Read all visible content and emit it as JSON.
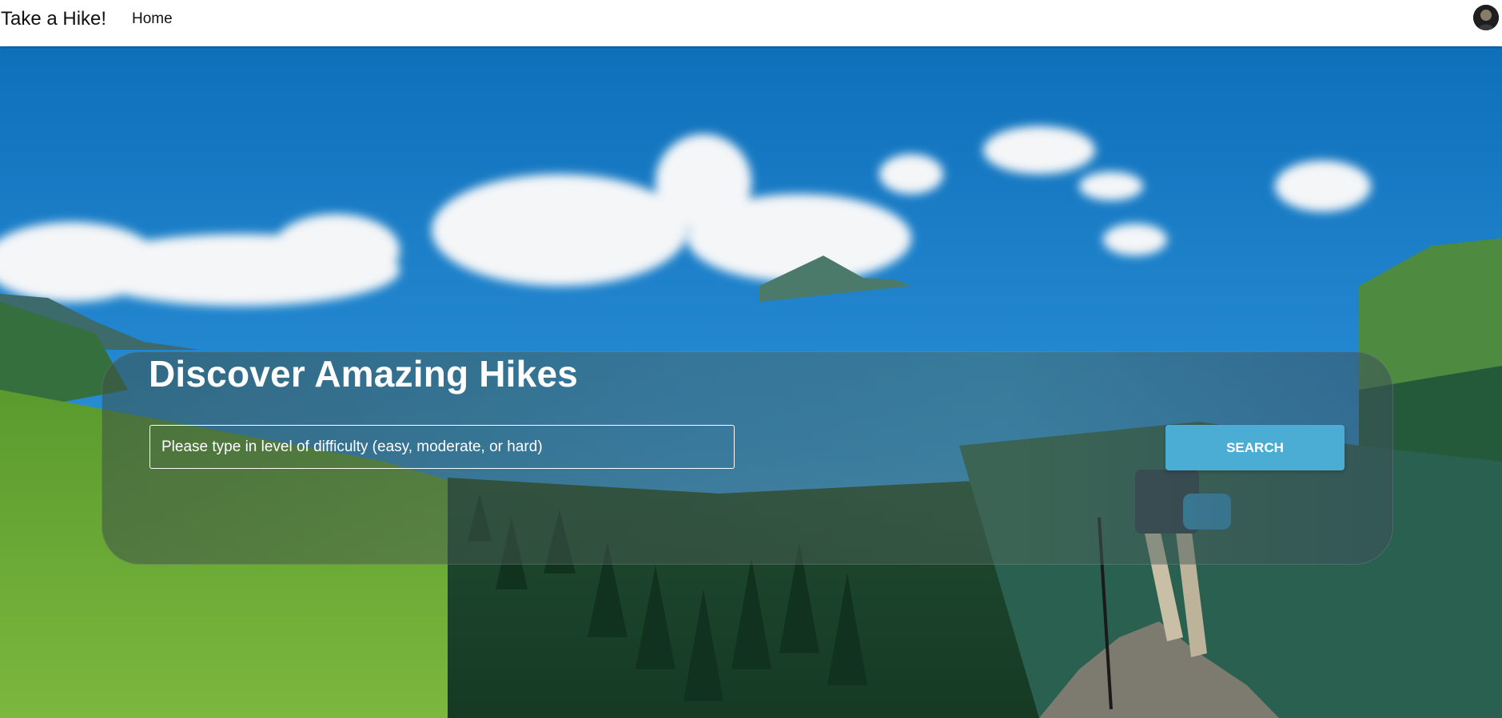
{
  "navbar": {
    "brand": "Take a Hike!",
    "links": [
      {
        "label": "Home"
      }
    ],
    "avatar_icon": "user-avatar"
  },
  "hero": {
    "title": "Discover Amazing Hikes",
    "search": {
      "placeholder": "Please type in level of difficulty (easy, moderate, or hard)",
      "value": ""
    },
    "button_label": "SEARCH",
    "colors": {
      "accent": "#4badd3",
      "sky": "#1a7bc4",
      "grass": "#5a9a2e"
    }
  }
}
